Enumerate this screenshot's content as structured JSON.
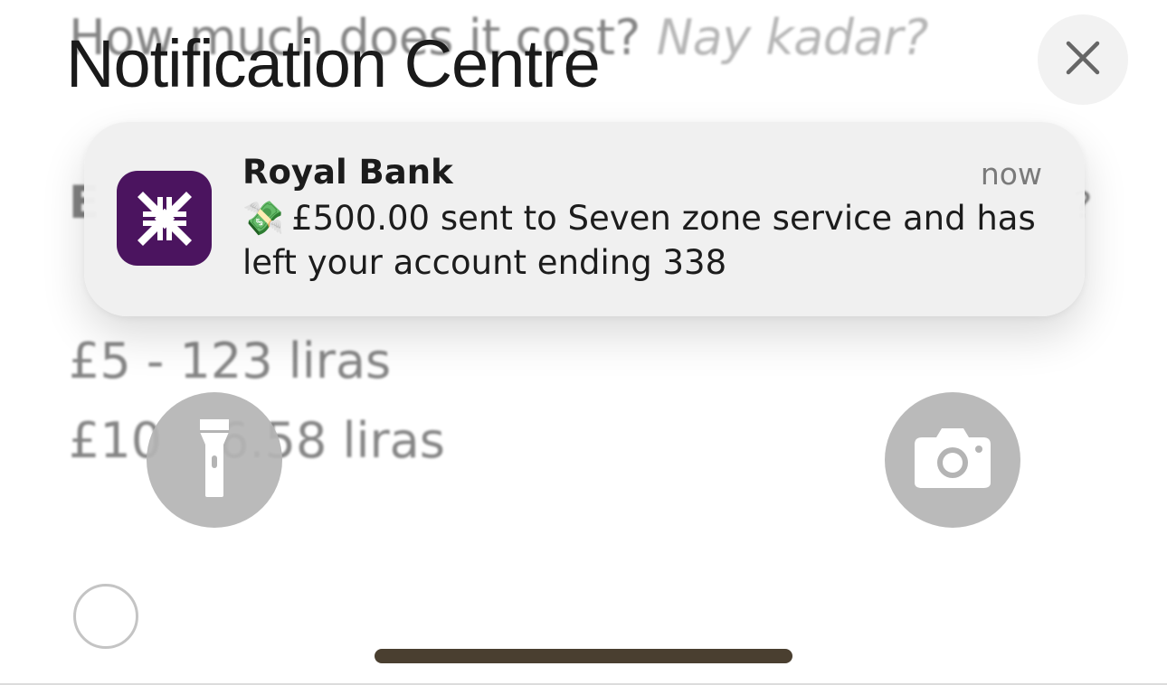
{
  "background": {
    "heading": "How much does it cost?",
    "heading_italic": "Nay kadar?",
    "partial_left": "E",
    "partial_right": "?",
    "line1": "£5 - 123 liras",
    "line2_left": "£10",
    "line2_right": "6.58 liras"
  },
  "notification_centre": {
    "title": "Notification Centre",
    "close_icon": "close-icon"
  },
  "notification": {
    "app_name": "Royal Bank",
    "time": "now",
    "emoji": "💸",
    "message": "£500.00 sent to Seven zone service and has left your account ending 338",
    "icon_color": "#4b145f",
    "icon": "royal-bank-logo"
  },
  "quick_actions": {
    "left_icon": "flashlight-icon",
    "right_icon": "camera-icon"
  },
  "colors": {
    "notification_bg": "#f0f0f0",
    "button_bg": "#b4b4b4",
    "home_indicator": "#4a3f30"
  }
}
